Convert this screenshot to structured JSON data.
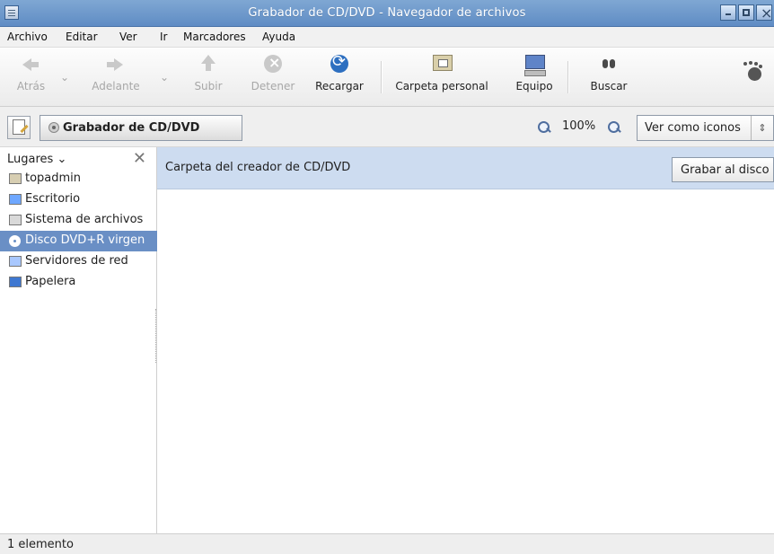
{
  "window": {
    "title": "Grabador de CD/DVD - Navegador de archivos"
  },
  "menu": {
    "items": [
      {
        "label": "Archivo"
      },
      {
        "label": "Editar"
      },
      {
        "label": "Ver"
      },
      {
        "label": "Ir"
      },
      {
        "label": "Marcadores"
      },
      {
        "label": "Ayuda"
      }
    ]
  },
  "toolbar": {
    "back": "Atrás",
    "forward": "Adelante",
    "up": "Subir",
    "stop": "Detener",
    "reload": "Recargar",
    "home": "Carpeta personal",
    "computer": "Equipo",
    "search": "Buscar"
  },
  "location": {
    "path_label": "Grabador de CD/DVD",
    "zoom": "100%",
    "view_mode": "Ver como iconos"
  },
  "sidebar": {
    "header": "Lugares",
    "items": [
      {
        "label": "topadmin",
        "icon": "home-folder-icon"
      },
      {
        "label": "Escritorio",
        "icon": "desktop-icon"
      },
      {
        "label": "Sistema de archivos",
        "icon": "filesystem-icon"
      },
      {
        "label": "Disco DVD+R virgen",
        "icon": "disc-icon"
      },
      {
        "label": "Servidores de red",
        "icon": "network-icon"
      },
      {
        "label": "Papelera",
        "icon": "trash-icon"
      }
    ]
  },
  "content": {
    "banner_text": "Carpeta del creador de CD/DVD",
    "burn_button": "Grabar al disco"
  },
  "status": {
    "text": "1 elemento"
  }
}
